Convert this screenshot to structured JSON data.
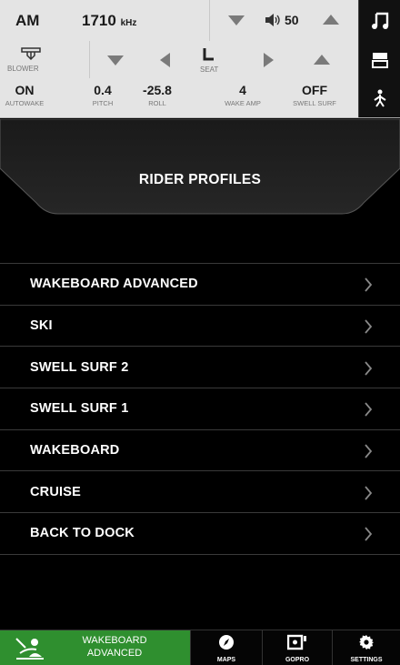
{
  "status": {
    "band": "AM",
    "frequency": "1710",
    "frequency_unit": "kHz",
    "volume": "50"
  },
  "climate": {
    "blower_label": "BLOWER",
    "seat_label": "SEAT"
  },
  "stats": [
    {
      "value": "ON",
      "label": "AUTOWAKE"
    },
    {
      "value": "0.4",
      "label": "PITCH"
    },
    {
      "value": "-25.8",
      "label": "ROLL"
    },
    {
      "value": "4",
      "label": "WAKE AMP"
    },
    {
      "value": "OFF",
      "label": "SWELL SURF"
    }
  ],
  "header": {
    "title": "RIDER PROFILES"
  },
  "profiles": [
    {
      "label": "WAKEBOARD ADVANCED"
    },
    {
      "label": "SKI"
    },
    {
      "label": "SWELL SURF 2"
    },
    {
      "label": "SWELL SURF 1"
    },
    {
      "label": "WAKEBOARD"
    },
    {
      "label": "CRUISE"
    },
    {
      "label": "BACK TO DOCK"
    }
  ],
  "nav": {
    "active_line1": "WAKEBOARD",
    "active_line2": "ADVANCED",
    "maps": "MAPS",
    "gopro": "GOPRO",
    "settings": "SETTINGS"
  },
  "colors": {
    "accent_green": "#2f8f2f",
    "panel_gray": "#e4e4e4",
    "background": "#000000"
  },
  "icons": {
    "music": "music-note-icon",
    "ballast": "ballast-icon",
    "rider": "rider-icon",
    "blower": "blower-icon",
    "seat": "seat-icon",
    "volume": "speaker-icon",
    "maps": "compass-icon",
    "gopro": "camera-icon",
    "settings": "gear-icon",
    "profile": "rider-profile-icon"
  }
}
